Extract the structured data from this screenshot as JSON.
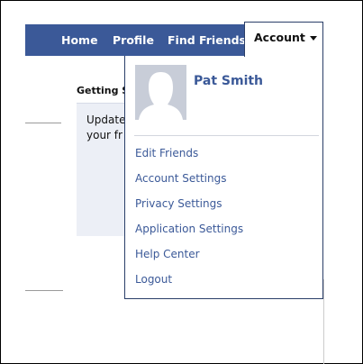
{
  "nav": {
    "items": [
      "Home",
      "Profile",
      "Find Friends"
    ],
    "account_label": "Account"
  },
  "page": {
    "section_title": "Getting S",
    "box_lines": [
      "Update",
      "your fr"
    ]
  },
  "dropdown": {
    "user_name": "Pat Smith",
    "menu": [
      "Edit Friends",
      "Account Settings",
      "Privacy Settings",
      "Application Settings",
      "Help Center",
      "Logout"
    ]
  },
  "colors": {
    "brand_blue": "#3b5998",
    "panel_bg": "#eceff6"
  }
}
